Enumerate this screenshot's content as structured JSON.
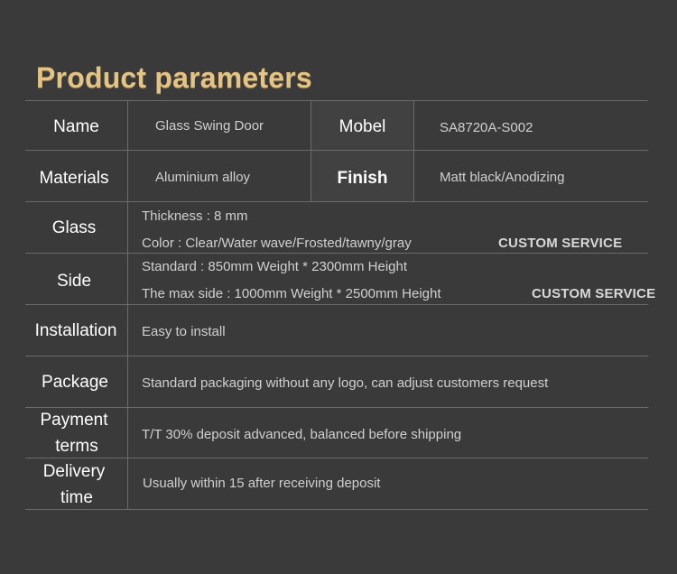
{
  "title": "Product parameters",
  "rows": {
    "name": {
      "label": "Name",
      "value": "Glass Swing Door"
    },
    "mobel": {
      "label": "Mobel",
      "value": "SA8720A-S002"
    },
    "materials": {
      "label": "Materials",
      "value": "Aluminium alloy"
    },
    "finish": {
      "label": "Finish",
      "value": "Matt black/Anodizing"
    },
    "glass": {
      "label": "Glass",
      "line1": "Thickness : 8 mm",
      "line2": "Color : Clear/Water wave/Frosted/tawny/gray",
      "badge": "CUSTOM SERVICE"
    },
    "side": {
      "label": "Side",
      "line1": "Standard : 850mm Weight * 2300mm Height",
      "line2": "The max side : 1000mm Weight * 2500mm Height",
      "badge": "CUSTOM SERVICE"
    },
    "installation": {
      "label": "Installation",
      "value": "Easy to install"
    },
    "package": {
      "label": "Package",
      "value": "Standard packaging without any logo, can adjust customers request"
    },
    "payment": {
      "label_line1": "Payment",
      "label_line2": "terms",
      "value": "T/T 30% deposit advanced, balanced before shipping"
    },
    "delivery": {
      "label_line1": "Delivery",
      "label_line2": "time",
      "value": "Usually within 15 after receiving deposit"
    }
  }
}
